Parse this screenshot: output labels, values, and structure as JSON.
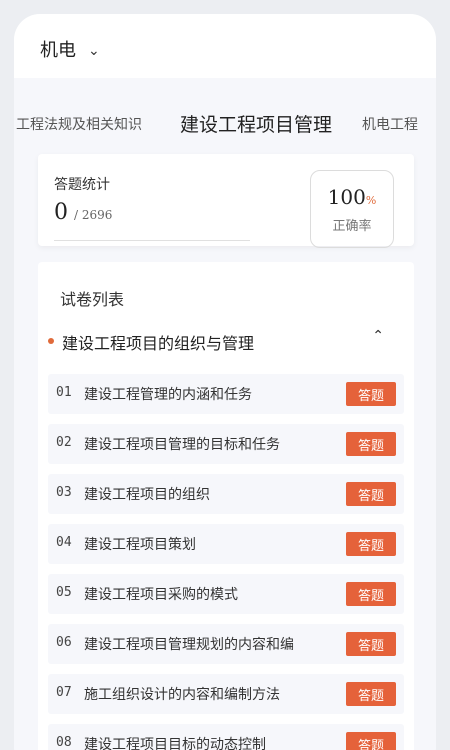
{
  "header": {
    "category": "机电",
    "chevron": "chevron-down-icon"
  },
  "tabs": [
    {
      "label": "工程法规及相关知识"
    },
    {
      "label": "建设工程项目管理"
    },
    {
      "label": "机电工程"
    }
  ],
  "stats": {
    "title": "答题统计",
    "answered": "0",
    "total": "/ 2696",
    "accuracy": "100",
    "accuracy_unit": "%",
    "accuracy_label": "正确率"
  },
  "paper_list": {
    "title": "试卷列表",
    "section_title": "建设工程项目的组织与管理",
    "accent_color": "#e5623a",
    "button_label": "答题",
    "items": [
      {
        "num": "01",
        "title": "建设工程管理的内涵和任务"
      },
      {
        "num": "02",
        "title": "建设工程项目管理的目标和任务"
      },
      {
        "num": "03",
        "title": "建设工程项目的组织"
      },
      {
        "num": "04",
        "title": "建设工程项目策划"
      },
      {
        "num": "05",
        "title": "建设工程项目采购的模式"
      },
      {
        "num": "06",
        "title": "建设工程项目管理规划的内容和编"
      },
      {
        "num": "07",
        "title": "施工组织设计的内容和编制方法"
      },
      {
        "num": "08",
        "title": "建设工程项目目标的动态控制"
      }
    ]
  }
}
